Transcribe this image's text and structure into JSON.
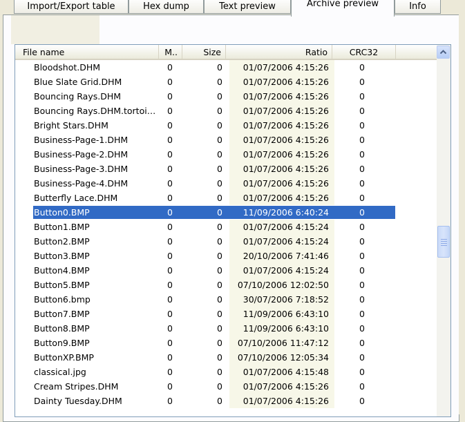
{
  "tabs": [
    {
      "label": "Import/Export table",
      "active": false
    },
    {
      "label": "Hex dump",
      "active": false
    },
    {
      "label": "Text preview",
      "active": false
    },
    {
      "label": "Archive preview",
      "active": true
    },
    {
      "label": "Info",
      "active": false
    }
  ],
  "columns": {
    "name": "File name",
    "m": "M..",
    "size": "Size",
    "ratio": "Ratio",
    "crc": "CRC32"
  },
  "rows": [
    {
      "name": "Bloodshot.DHM",
      "m": "0",
      "size": "0",
      "date": "01/07/2006 4:15:26",
      "crc": "0"
    },
    {
      "name": "Blue Slate Grid.DHM",
      "m": "0",
      "size": "0",
      "date": "01/07/2006 4:15:26",
      "crc": "0"
    },
    {
      "name": "Bouncing Rays.DHM",
      "m": "0",
      "size": "0",
      "date": "01/07/2006 4:15:26",
      "crc": "0"
    },
    {
      "name": "Bouncing Rays.DHM.tortoi…",
      "m": "0",
      "size": "0",
      "date": "01/07/2006 4:15:26",
      "crc": "0"
    },
    {
      "name": "Bright Stars.DHM",
      "m": "0",
      "size": "0",
      "date": "01/07/2006 4:15:26",
      "crc": "0"
    },
    {
      "name": "Business-Page-1.DHM",
      "m": "0",
      "size": "0",
      "date": "01/07/2006 4:15:26",
      "crc": "0"
    },
    {
      "name": "Business-Page-2.DHM",
      "m": "0",
      "size": "0",
      "date": "01/07/2006 4:15:26",
      "crc": "0"
    },
    {
      "name": "Business-Page-3.DHM",
      "m": "0",
      "size": "0",
      "date": "01/07/2006 4:15:26",
      "crc": "0"
    },
    {
      "name": "Business-Page-4.DHM",
      "m": "0",
      "size": "0",
      "date": "01/07/2006 4:15:26",
      "crc": "0"
    },
    {
      "name": "Butterfly Lace.DHM",
      "m": "0",
      "size": "0",
      "date": "01/07/2006 4:15:26",
      "crc": "0"
    },
    {
      "name": "Button0.BMP",
      "m": "0",
      "size": "0",
      "date": "11/09/2006 6:40:24",
      "crc": "0",
      "selected": true
    },
    {
      "name": "Button1.BMP",
      "m": "0",
      "size": "0",
      "date": "01/07/2006 4:15:24",
      "crc": "0"
    },
    {
      "name": "Button2.BMP",
      "m": "0",
      "size": "0",
      "date": "01/07/2006 4:15:24",
      "crc": "0"
    },
    {
      "name": "Button3.BMP",
      "m": "0",
      "size": "0",
      "date": "20/10/2006 7:41:46",
      "crc": "0"
    },
    {
      "name": "Button4.BMP",
      "m": "0",
      "size": "0",
      "date": "01/07/2006 4:15:24",
      "crc": "0"
    },
    {
      "name": "Button5.BMP",
      "m": "0",
      "size": "0",
      "date": "07/10/2006 12:02:50",
      "crc": "0"
    },
    {
      "name": "Button6.bmp",
      "m": "0",
      "size": "0",
      "date": "30/07/2006 7:18:52",
      "crc": "0"
    },
    {
      "name": "Button7.BMP",
      "m": "0",
      "size": "0",
      "date": "11/09/2006 6:43:10",
      "crc": "0"
    },
    {
      "name": "Button8.BMP",
      "m": "0",
      "size": "0",
      "date": "11/09/2006 6:43:10",
      "crc": "0"
    },
    {
      "name": "Button9.BMP",
      "m": "0",
      "size": "0",
      "date": "07/10/2006 11:47:12",
      "crc": "0"
    },
    {
      "name": "ButtonXP.BMP",
      "m": "0",
      "size": "0",
      "date": "07/10/2006 12:05:34",
      "crc": "0"
    },
    {
      "name": "classical.jpg",
      "m": "0",
      "size": "0",
      "date": "01/07/2006 4:15:48",
      "crc": "0"
    },
    {
      "name": "Cream Stripes.DHM",
      "m": "0",
      "size": "0",
      "date": "01/07/2006 4:15:26",
      "crc": "0"
    },
    {
      "name": "Dainty Tuesday.DHM",
      "m": "0",
      "size": "0",
      "date": "01/07/2006 4:15:26",
      "crc": "0"
    }
  ],
  "scrollbar": {
    "up_icon": "chevron-up-icon",
    "grip_icon": "grip-icon"
  },
  "colors": {
    "selection": "#316ac5",
    "date_column_bg": "#f7f7e8",
    "frame": "#7f9db9"
  }
}
